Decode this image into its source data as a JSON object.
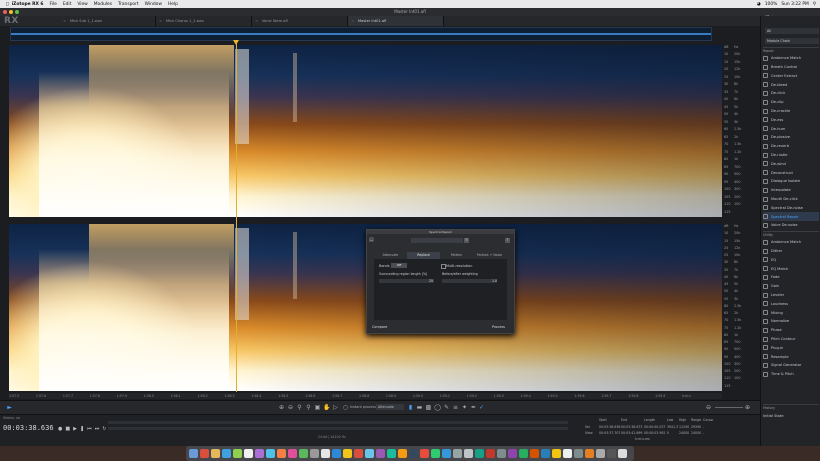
{
  "menubar": {
    "apple": "",
    "app_name": "iZotope RX 6",
    "menus": [
      "File",
      "Edit",
      "View",
      "Modules",
      "Transport",
      "Window",
      "Help"
    ],
    "status": [
      "100%",
      "Sun 3:22 PM"
    ]
  },
  "window": {
    "title": "Master Int01.afl"
  },
  "tabs": [
    {
      "label": "Mick Sub 1_1.wav",
      "active": false
    },
    {
      "label": "Mick Chorus 1_1.wav",
      "active": false
    },
    {
      "label": "Vocal Stem.afl",
      "active": false
    },
    {
      "label": "Master Int01.afl",
      "active": true
    }
  ],
  "logo": {
    "rx": "RX",
    "brand": "iZotope"
  },
  "scale_top": [
    "dB",
    "10",
    "15",
    "20",
    "25",
    "30",
    "35",
    "40",
    "45",
    "50",
    "55",
    "60",
    "65",
    "70",
    "75",
    "80",
    "85",
    "90",
    "95",
    "100",
    "105",
    "110",
    "115"
  ],
  "scale_top_hz": [
    "Hz",
    "20k",
    "15k",
    "12k",
    "10k",
    "8k",
    "7k",
    "6k",
    "5k",
    "4k",
    "3k",
    "2.5k",
    "2k",
    "1.5k",
    "1.2k",
    "1k",
    "700",
    "500",
    "400",
    "300",
    "200",
    "100"
  ],
  "scale_bottom": [
    "dB",
    "10",
    "15",
    "20",
    "25",
    "30",
    "35",
    "40",
    "45",
    "50",
    "55",
    "60",
    "65",
    "70",
    "75",
    "80",
    "85",
    "90",
    "95",
    "100",
    "105",
    "110",
    "115"
  ],
  "timeline": [
    "1:57.5",
    "1:57.6",
    "1:57.7",
    "1:57.8",
    "1:57.9",
    "1:58.0",
    "1:58.1",
    "1:58.2",
    "1:58.3",
    "1:58.4",
    "1:58.5",
    "1:58.6",
    "1:58.7",
    "1:58.8",
    "1:58.9",
    "1:59.0",
    "1:59.1",
    "1:59.2",
    "1:59.3",
    "1:59.4",
    "1:59.5",
    "1:59.6",
    "1:59.7",
    "1:59.8",
    "1:59.9",
    "h:m:s"
  ],
  "toolbar": {
    "instant_process": "Instant process",
    "mode": "Attenuate"
  },
  "transport": {
    "status": "Status: no",
    "timecode": "00:03:38.636",
    "format": "24-bit | 44100 Hz"
  },
  "selection": {
    "headers": [
      "Start",
      "End",
      "Length",
      "Low",
      "High",
      "Range",
      "Cursor"
    ],
    "sel": [
      "00:03:38.636",
      "00:03:38.673",
      "00:00:00.037",
      "3941.3",
      "11290",
      "29390",
      "-"
    ],
    "view": [
      "00:03:37.707",
      "00:03:41.699",
      "00:00:03.992",
      "0",
      "24000",
      "24000",
      "-"
    ],
    "units": "h:m:s.ms"
  },
  "panel": {
    "search_placeholder": "All",
    "module_chain": "Module Chain",
    "repair_header": "Repair",
    "repair": [
      "Ambience Match",
      "Breath Control",
      "Center Extract",
      "De-bleed",
      "De-click",
      "De-clip",
      "De-crackle",
      "De-ess",
      "De-hum",
      "De-plosive",
      "De-reverb",
      "De-rustle",
      "De-wind",
      "Deconstruct",
      "Dialogue Isolate",
      "Interpolate",
      "Mouth De-click",
      "Spectral De-noise",
      "Spectral Repair",
      "Voice De-noise"
    ],
    "selected": "Spectral Repair",
    "utility_header": "Utility",
    "utility": [
      "Ambience Match",
      "Dither",
      "EQ",
      "EQ Match",
      "Fade",
      "Gain",
      "Leveler",
      "Loudness",
      "Mixing",
      "Normalize",
      "Phase",
      "Pitch Contour",
      "Plug-in",
      "Resample",
      "Signal Generator",
      "Time & Pitch"
    ],
    "history_header": "History",
    "history": [
      "Initial State"
    ]
  },
  "dialog": {
    "title": "Spectral Repair",
    "tabs": [
      "Attenuate",
      "Replace",
      "Pattern",
      "Partials + Noise"
    ],
    "active_tab": "Replace",
    "bands_label": "Bands",
    "bands_value": "Off",
    "multi_res": "Multi-resolution",
    "surround_label": "Surrounding region length [%]",
    "surround_value": "25",
    "before_after_label": "Before/after weighting",
    "before_after_value": "1.0",
    "compare_btn": "Compare",
    "process_btn": "Process"
  },
  "dock_colors": [
    "#6a9bd8",
    "#d94f3d",
    "#e6b85c",
    "#3fa0e0",
    "#8fd14f",
    "#f0f0f0",
    "#a96fd6",
    "#4fc1e9",
    "#f57f45",
    "#e14f9a",
    "#5cb85c",
    "#999999",
    "#e6e6e6",
    "#2d88d8",
    "#f0c419",
    "#d94f3d",
    "#6ac3e8",
    "#9b59b6",
    "#1abc9c",
    "#f39c12",
    "#34495e",
    "#e74c3c",
    "#2ecc71",
    "#3498db",
    "#95a5a6",
    "#bdc3c7",
    "#16a085",
    "#c0392b",
    "#7f8c8d",
    "#8e44ad",
    "#27ae60",
    "#d35400",
    "#2980b9",
    "#f1c40f",
    "#ecf0f1",
    "#7f8c8d",
    "#e67e22",
    "#aaaaaa",
    "#555555",
    "#dddddd"
  ]
}
